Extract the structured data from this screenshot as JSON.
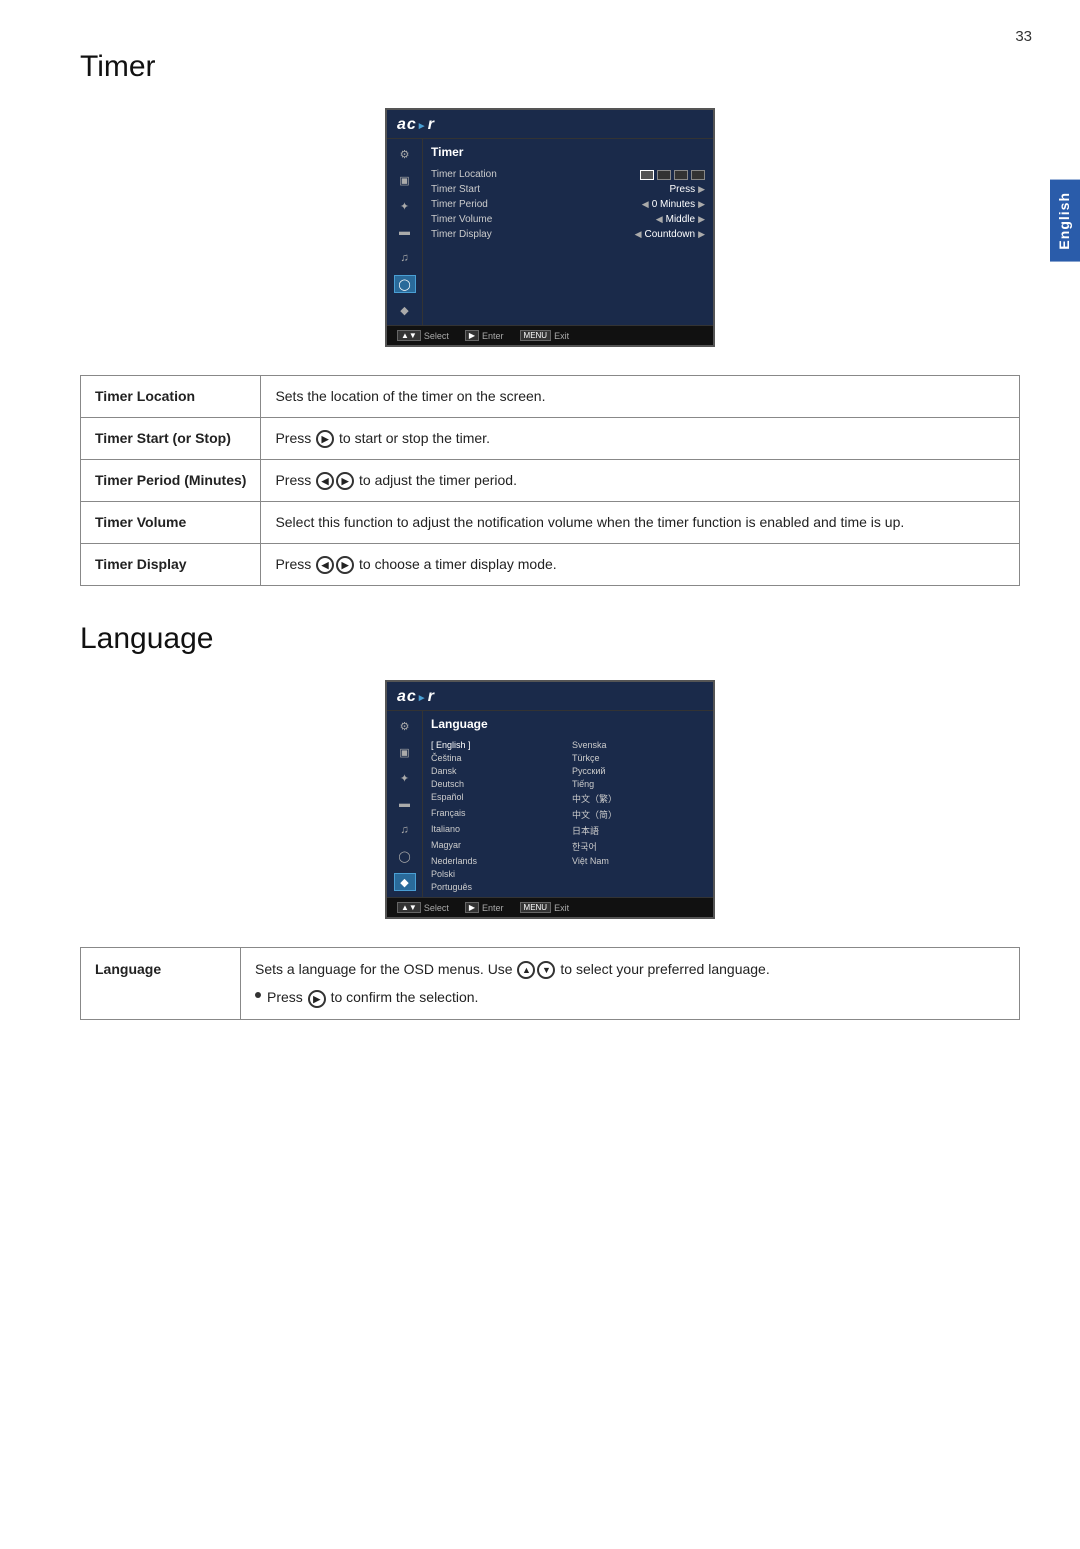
{
  "page": {
    "number": "33",
    "lang_tab": "English"
  },
  "timer_section": {
    "title": "Timer",
    "osd": {
      "logo": "acer",
      "section_title": "Timer",
      "rows": [
        {
          "label": "Timer Location",
          "value": "",
          "has_location_icons": true
        },
        {
          "label": "Timer Start",
          "value": "Press",
          "has_arrows": true
        },
        {
          "label": "Timer Period",
          "value": "0  Minutes",
          "has_arrows": true
        },
        {
          "label": "Timer Volume",
          "value": "Middle",
          "has_arrows": true
        },
        {
          "label": "Timer Display",
          "value": "Countdown",
          "has_arrows": true
        }
      ],
      "footer": [
        {
          "key": "▲▼",
          "label": "Select"
        },
        {
          "key": "▶",
          "label": "Enter"
        },
        {
          "key": "MENU",
          "label": "Exit"
        }
      ]
    },
    "table": [
      {
        "label": "Timer Location",
        "description": "Sets the location of the timer on the screen."
      },
      {
        "label": "Timer Start (or Stop)",
        "description": "Press ▶ to start or stop the timer.",
        "has_button": true,
        "button_type": "right"
      },
      {
        "label": "Timer Period (Minutes)",
        "description": "Press ◀▶ to adjust the timer period.",
        "has_buttons": true,
        "button_type": "both"
      },
      {
        "label": "Timer Volume",
        "description": "Select this function to adjust the notification volume when the timer function is enabled and time is up."
      },
      {
        "label": "Timer Display",
        "description": "Press ◀▶ to choose a timer display mode.",
        "has_buttons": true,
        "button_type": "both"
      }
    ]
  },
  "language_section": {
    "title": "Language",
    "osd": {
      "logo": "acer",
      "section_title": "Language",
      "languages_left": [
        "[ English ]",
        "Čeština",
        "Dansk",
        "Deutsch",
        "Español",
        "Français",
        "Italiano",
        "Magyar",
        "Nederlands",
        "Polski",
        "Português"
      ],
      "languages_right": [
        "Svenska",
        "Türkçe",
        "Русский",
        "Tiếng",
        "中文（繁）",
        "中文（简）",
        "日本語",
        "한국어",
        "Việt Nam"
      ]
    },
    "table": [
      {
        "label": "Language",
        "description": "Sets a language for the OSD menus. Use ▲▼ to select your preferred language.",
        "bullet": "Press ▶ to confirm the selection."
      }
    ]
  }
}
